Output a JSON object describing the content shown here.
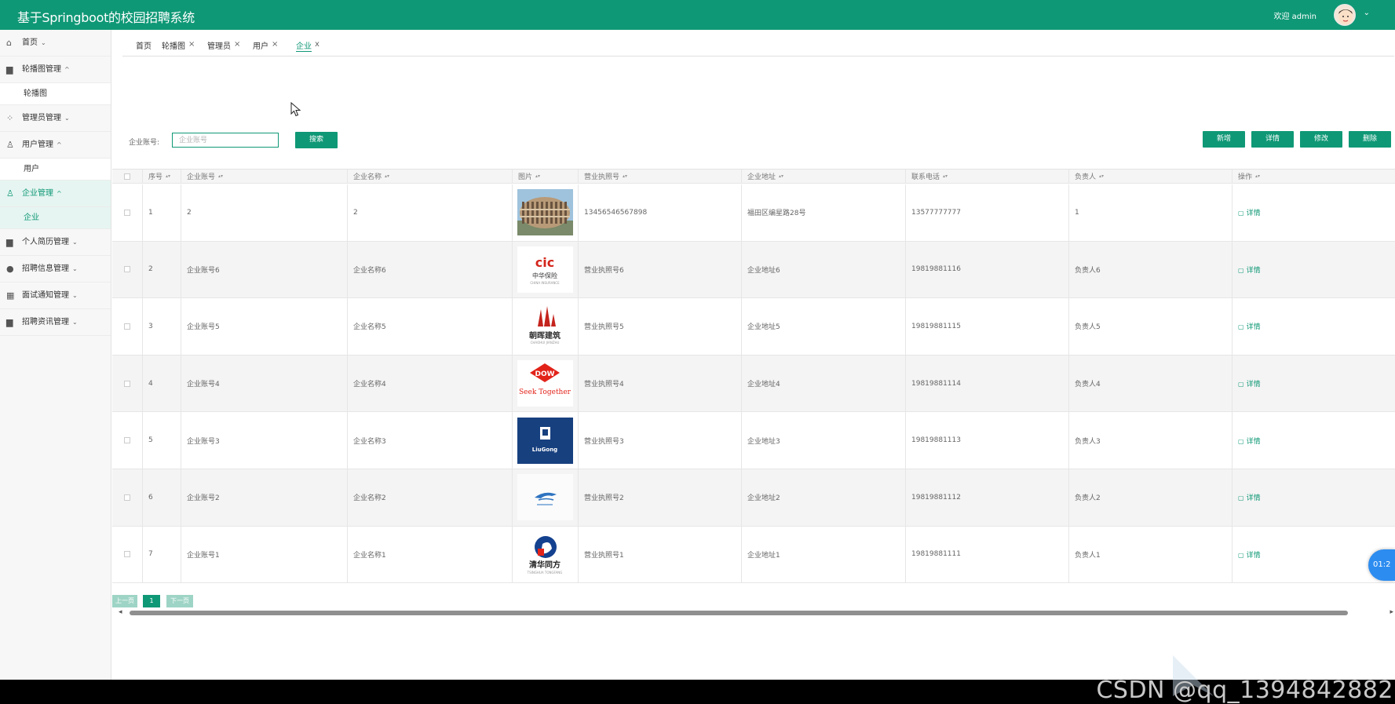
{
  "header": {
    "title": "基于Springboot的校园招聘系统",
    "welcome": "欢迎 admin",
    "caret": "⌄"
  },
  "sidebar": {
    "items": [
      {
        "icon": "home-icon",
        "glyph": "⌂",
        "label": "首页",
        "arrow": "⌄"
      },
      {
        "icon": "carousel-icon",
        "glyph": "▆",
        "label": "轮播图管理",
        "arrow": "^",
        "sub": "轮播图"
      },
      {
        "icon": "admin-icon",
        "glyph": "⁘",
        "label": "管理员管理",
        "arrow": "⌄"
      },
      {
        "icon": "user-icon",
        "glyph": "♙",
        "label": "用户管理",
        "arrow": "^",
        "sub": "用户"
      },
      {
        "icon": "company-icon",
        "glyph": "♙",
        "label": "企业管理",
        "arrow": "^",
        "sub": "企业"
      },
      {
        "icon": "resume-icon",
        "glyph": "▆",
        "label": "个人简历管理",
        "arrow": "⌄"
      },
      {
        "icon": "recruit-info-icon",
        "glyph": "●",
        "label": "招聘信息管理",
        "arrow": "⌄"
      },
      {
        "icon": "interview-icon",
        "glyph": "▦",
        "label": "面试通知管理",
        "arrow": "⌄"
      },
      {
        "icon": "news-icon",
        "glyph": "▆",
        "label": "招聘资讯管理",
        "arrow": "⌄"
      }
    ]
  },
  "tabs": [
    {
      "label": "首页",
      "close": ""
    },
    {
      "label": "轮播图",
      "close": "×"
    },
    {
      "label": "管理员",
      "close": "×"
    },
    {
      "label": "用户",
      "close": "×"
    },
    {
      "label": "企业",
      "close": "x"
    }
  ],
  "search": {
    "label": "企业账号:",
    "placeholder": "企业账号",
    "button": "搜索"
  },
  "actions": {
    "add": "新增",
    "detail": "详情",
    "edit": "修改",
    "delete": "删除"
  },
  "table": {
    "columns": [
      "序号",
      "企业账号",
      "企业名称",
      "图片",
      "营业执照号",
      "企业地址",
      "联系电话",
      "负责人",
      "操作"
    ],
    "rows": [
      {
        "no": "1",
        "account": "2",
        "name": "2",
        "image": "building-photo",
        "license": "13456546567898",
        "address": "福田区编星路28号",
        "phone": "13577777777",
        "owner": "1",
        "op": "详情"
      },
      {
        "no": "2",
        "account": "企业账号6",
        "name": "企业名称6",
        "image": "logo-zhonghua-baoxian",
        "license": "营业执照号6",
        "address": "企业地址6",
        "phone": "19819881116",
        "owner": "负责人6",
        "op": "详情"
      },
      {
        "no": "3",
        "account": "企业账号5",
        "name": "企业名称5",
        "image": "logo-chaohui-jianzhu",
        "license": "营业执照号5",
        "address": "企业地址5",
        "phone": "19819881115",
        "owner": "负责人5",
        "op": "详情"
      },
      {
        "no": "4",
        "account": "企业账号4",
        "name": "企业名称4",
        "image": "logo-dow",
        "license": "营业执照号4",
        "address": "企业地址4",
        "phone": "19819881114",
        "owner": "负责人4",
        "op": "详情"
      },
      {
        "no": "5",
        "account": "企业账号3",
        "name": "企业名称3",
        "image": "logo-liugong",
        "license": "营业执照号3",
        "address": "企业地址3",
        "phone": "19819881113",
        "owner": "负责人3",
        "op": "详情"
      },
      {
        "no": "6",
        "account": "企业账号2",
        "name": "企业名称2",
        "image": "logo-airline",
        "license": "营业执照号2",
        "address": "企业地址2",
        "phone": "19819881112",
        "owner": "负责人2",
        "op": "详情"
      },
      {
        "no": "7",
        "account": "企业账号1",
        "name": "企业名称1",
        "image": "logo-tsinghua-tongfang",
        "license": "营业执照号1",
        "address": "企业地址1",
        "phone": "19819881111",
        "owner": "负责人1",
        "op": "详情"
      }
    ]
  },
  "logos": {
    "zhonghua": "中华保险",
    "chaohui": "朝晖建筑",
    "dow": "DOW",
    "dow_tagline": "Seek Together",
    "liugong": "LiuGong",
    "tongfang": "清华同方"
  },
  "pager": {
    "prev": "上一页",
    "current": "1",
    "next": "下一页"
  },
  "float_bubble": "01:2",
  "watermark": "CSDN @qq_1394842882",
  "colors": {
    "primary": "#0f9876",
    "bubble": "#2d8cf0"
  }
}
